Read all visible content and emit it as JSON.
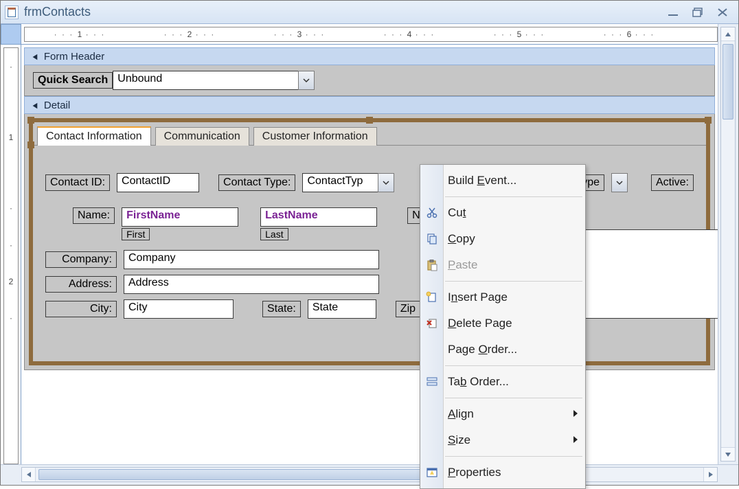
{
  "window": {
    "title": "frmContacts"
  },
  "ruler": {
    "h_ticks": [
      "1",
      "2",
      "3",
      "4",
      "5",
      "6"
    ],
    "v_ticks": [
      "1",
      "2"
    ]
  },
  "sections": {
    "form_header": "Form Header",
    "detail": "Detail"
  },
  "quick_search": {
    "label": "Quick Search",
    "value": "Unbound"
  },
  "tabs": [
    {
      "label": "Contact Information"
    },
    {
      "label": "Communication"
    },
    {
      "label": "Customer Information"
    }
  ],
  "fields": {
    "contact_id_label": "Contact ID:",
    "contact_id_value": "ContactID",
    "contact_type_label": "Contact Type:",
    "contact_type_value": "ContactTyp",
    "type_trunc_label": "ype",
    "active_label": "Active:",
    "name_label": "Name:",
    "first_name_value": "FirstName",
    "last_name_value": "LastName",
    "first_sublabel": "First",
    "last_sublabel": "Last",
    "notes_trunc_label": "No",
    "company_label": "Company:",
    "company_value": "Company",
    "address_label": "Address:",
    "address_value": "Address",
    "city_label": "City:",
    "city_value": "City",
    "state_label": "State:",
    "state_value": "State",
    "zip_label": "Zip"
  },
  "context_menu": {
    "build_event": "Build Event...",
    "cut": "Cut",
    "copy": "Copy",
    "paste": "Paste",
    "insert_page": "Insert Page",
    "delete_page": "Delete Page",
    "page_order": "Page Order...",
    "tab_order": "Tab Order...",
    "align": "Align",
    "size": "Size",
    "properties": "Properties"
  }
}
